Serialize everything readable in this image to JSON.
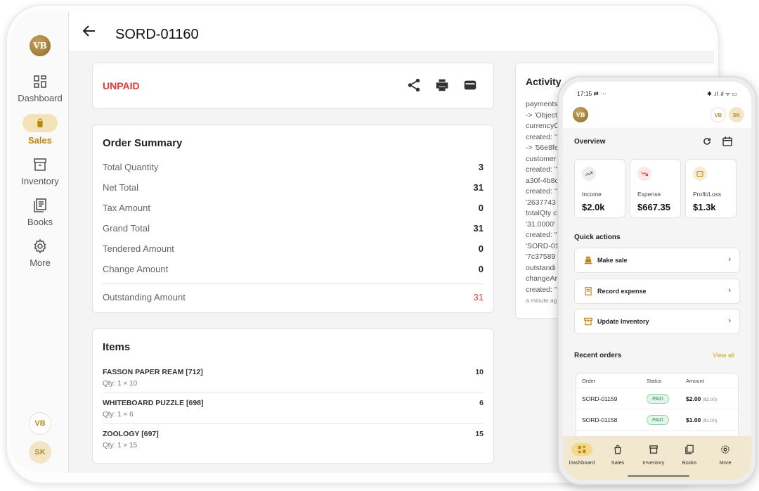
{
  "tablet": {
    "brand": "VB",
    "nav": [
      {
        "label": "Dashboard"
      },
      {
        "label": "Sales"
      },
      {
        "label": "Inventory"
      },
      {
        "label": "Books"
      },
      {
        "label": "More"
      }
    ],
    "avatars": [
      "VB",
      "SK"
    ],
    "title": "SORD-01160",
    "status": "UNPAID",
    "summary": {
      "heading": "Order Summary",
      "rows": [
        {
          "label": "Total Quantity",
          "value": "3"
        },
        {
          "label": "Net Total",
          "value": "31"
        },
        {
          "label": "Tax Amount",
          "value": "0"
        },
        {
          "label": "Grand Total",
          "value": "31"
        },
        {
          "label": "Tendered Amount",
          "value": "0"
        },
        {
          "label": "Change Amount",
          "value": "0"
        }
      ],
      "outstanding_label": "Outstanding Amount",
      "outstanding_value": "31"
    },
    "items": {
      "heading": "Items",
      "list": [
        {
          "name": "FASSON PAPER REAM [712]",
          "qty": "Qty: 1 × 10",
          "value": "10"
        },
        {
          "name": "WHITEBOARD PUZZLE [698]",
          "qty": "Qty: 1 × 6",
          "value": "6"
        },
        {
          "name": "ZOOLOGY [697]",
          "qty": "Qty: 1 × 15",
          "value": "15"
        }
      ]
    },
    "activity": {
      "heading": "Activity",
      "lines": [
        "payments",
        "-> 'Object",
        "currencyC",
        "created: \"",
        "-> '56e8fe",
        "customer",
        "created: \"",
        "a30f-4b8c",
        "created: \"",
        "'2637743",
        "totalQty c",
        "'31.0000'",
        "created: \"",
        "'SORD-01",
        "'7c37589",
        "outstandi",
        "changeAr",
        "created: \""
      ],
      "time": "a minute ag"
    }
  },
  "phone": {
    "time": "17:15",
    "status_icons": "⇄ ···",
    "status_right": "✱ .ıl .ıl ᯤ ▭",
    "brand": "VB",
    "avatars": [
      "VB",
      "SK"
    ],
    "overview_heading": "Overview",
    "stats": [
      {
        "label": "Income",
        "value": "$2.0k"
      },
      {
        "label": "Expense",
        "value": "$667.35"
      },
      {
        "label": "Profit/Loss",
        "value": "$1.3k"
      }
    ],
    "quick_heading": "Quick actions",
    "quick_actions": [
      {
        "label": "Make sale"
      },
      {
        "label": "Record expense"
      },
      {
        "label": "Update Inventory"
      }
    ],
    "recent_heading": "Recent orders",
    "view_all": "View all",
    "orders_columns": [
      "Order",
      "Status",
      "Amount"
    ],
    "orders": [
      {
        "id": "SORD-01159",
        "status": "PAID",
        "amount": "$2.00",
        "sub": "($2.00)"
      },
      {
        "id": "SORD-01158",
        "status": "PAID",
        "amount": "$1.00",
        "sub": "($1.00)"
      }
    ],
    "nav": [
      {
        "label": "Dashboard"
      },
      {
        "label": "Sales"
      },
      {
        "label": "Inventory"
      },
      {
        "label": "Books"
      },
      {
        "label": "More"
      }
    ]
  }
}
